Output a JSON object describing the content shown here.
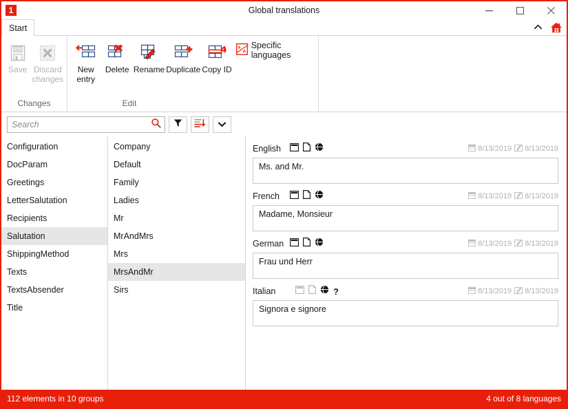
{
  "window": {
    "title": "Global translations",
    "app_icon": "1",
    "minimize_label": "–",
    "maximize_label": "□",
    "close_label": "✕"
  },
  "ribbon": {
    "tab": "Start",
    "collapse_icon": "chevron-up-icon",
    "home_icon": "home-icon",
    "groups": [
      {
        "label": "Changes",
        "buttons": [
          {
            "label": "Save",
            "icon": "save-icon",
            "disabled": true
          },
          {
            "label": "Discard changes",
            "icon": "discard-icon",
            "disabled": true
          }
        ]
      },
      {
        "label": "Edit",
        "buttons": [
          {
            "label": "New entry",
            "icon": "new-entry-icon",
            "disabled": false
          },
          {
            "label": "Delete",
            "icon": "delete-icon",
            "disabled": false
          },
          {
            "label": "Rename",
            "icon": "rename-icon",
            "disabled": false
          },
          {
            "label": "Duplicate",
            "icon": "duplicate-icon",
            "disabled": false
          },
          {
            "label": "Copy ID",
            "icon": "copy-id-icon",
            "disabled": false
          }
        ],
        "small_button": {
          "label": "Specific languages",
          "icon": "specific-languages-icon"
        }
      }
    ]
  },
  "search": {
    "value": "",
    "placeholder": "Search",
    "search_icon": "magnifier-icon",
    "filter_icon": "funnel-icon",
    "sort_icon": "sort-descending-icon",
    "more_icon": "chevron-down-icon"
  },
  "groups_list": {
    "selected": "Salutation",
    "items": [
      {
        "label": "Configuration"
      },
      {
        "label": "DocParam"
      },
      {
        "label": "Greetings"
      },
      {
        "label": "LetterSalutation"
      },
      {
        "label": "Recipients"
      },
      {
        "label": "Salutation"
      },
      {
        "label": "ShippingMethod"
      },
      {
        "label": "Texts"
      },
      {
        "label": "TextsAbsender"
      },
      {
        "label": "Title"
      }
    ]
  },
  "entries_list": {
    "selected": "MrsAndMr",
    "items": [
      {
        "label": "Company"
      },
      {
        "label": "Default"
      },
      {
        "label": "Family"
      },
      {
        "label": "Ladies"
      },
      {
        "label": "Mr"
      },
      {
        "label": "MrAndMrs"
      },
      {
        "label": "Mrs"
      },
      {
        "label": "MrsAndMr"
      },
      {
        "label": "Sirs"
      }
    ]
  },
  "detail": {
    "languages": [
      {
        "name": "English",
        "value": "Ms. and Mr.",
        "icons": [
          "window-icon",
          "document-icon",
          "globe-icon"
        ],
        "dimmed": false,
        "has_question": false,
        "created_date": "8/13/2019",
        "modified_date": "8/13/2019"
      },
      {
        "name": "French",
        "value": "Madame, Monsieur",
        "icons": [
          "window-icon",
          "document-icon",
          "globe-icon"
        ],
        "dimmed": false,
        "has_question": false,
        "created_date": "8/13/2019",
        "modified_date": "8/13/2019"
      },
      {
        "name": "German",
        "value": "Frau und Herr",
        "icons": [
          "window-icon",
          "document-icon",
          "globe-icon"
        ],
        "dimmed": false,
        "has_question": false,
        "created_date": "8/13/2019",
        "modified_date": "8/13/2019"
      },
      {
        "name": "Italian",
        "value": "Signora e signore",
        "icons": [
          "window-icon",
          "document-icon",
          "globe-icon"
        ],
        "dimmed": true,
        "has_question": true,
        "question_label": "?",
        "created_date": "8/13/2019",
        "modified_date": "8/13/2019"
      }
    ],
    "calendar_icon": "calendar-icon",
    "edit_icon": "edit-pencil-icon"
  },
  "statusbar": {
    "left": "112 elements in 10 groups",
    "right": "4 out of 8 languages"
  },
  "colors": {
    "accent": "#e8200b",
    "selection": "#e6e6e6",
    "border": "#d4d4d4",
    "muted_text": "#b0b0b0"
  }
}
